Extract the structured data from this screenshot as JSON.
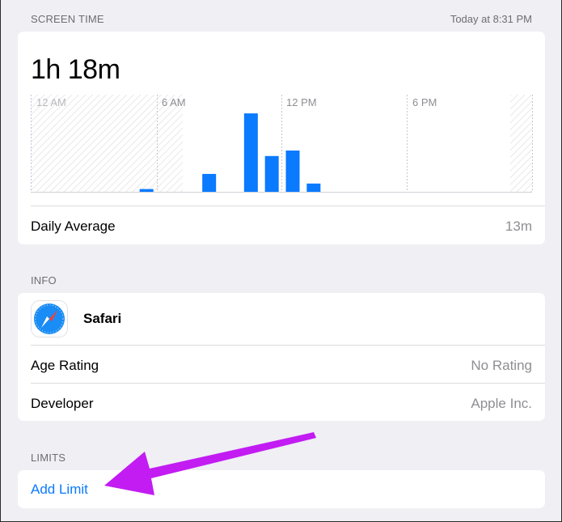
{
  "screen_time": {
    "header": "SCREEN TIME",
    "timestamp": "Today at 8:31 PM",
    "total": "1h 18m",
    "daily_average_label": "Daily Average",
    "daily_average_value": "13m"
  },
  "chart_data": {
    "type": "bar",
    "x_tick_labels": [
      "12 AM",
      "6 AM",
      "12 PM",
      "6 PM"
    ],
    "bar_color": "#0a7aff",
    "unit": "minutes",
    "bars": [
      {
        "hour": 5,
        "minutes": 2
      },
      {
        "hour": 8,
        "minutes": 13
      },
      {
        "hour": 10,
        "minutes": 57
      },
      {
        "hour": 11,
        "minutes": 26
      },
      {
        "hour": 12,
        "minutes": 30
      },
      {
        "hour": 13,
        "minutes": 6
      }
    ],
    "ylim": [
      0,
      60
    ]
  },
  "info": {
    "header": "INFO",
    "app_name": "Safari",
    "app_icon": "safari-compass-icon",
    "rows": [
      {
        "label": "Age Rating",
        "value": "No Rating"
      },
      {
        "label": "Developer",
        "value": "Apple Inc."
      }
    ]
  },
  "limits": {
    "header": "LIMITS",
    "add_limit": "Add Limit"
  },
  "annotation": {
    "arrow_color": "#c21cf2",
    "arrow_icon": "pointer-arrow"
  }
}
